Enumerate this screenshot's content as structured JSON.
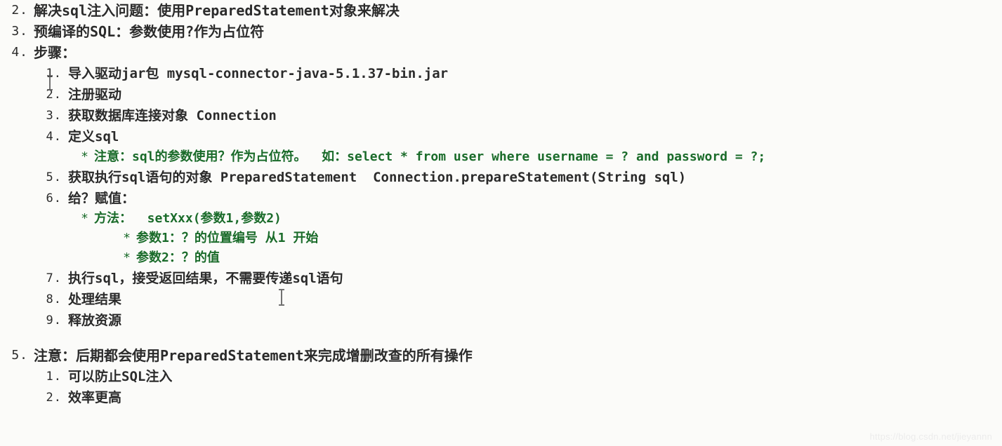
{
  "document": {
    "type": "markdown-outline-note",
    "topic": "PreparedStatement",
    "background_color": "#fbfbf9",
    "text_color": "#2b2b2b",
    "accent_color": "#1a6b2a"
  },
  "outline": {
    "item2": {
      "marker": "2.",
      "text": "解决sql注入问题：使用PreparedStatement对象来解决"
    },
    "item3": {
      "marker": "3.",
      "text": "预编译的SQL：参数使用?作为占位符"
    },
    "item4": {
      "marker": "4.",
      "text": "步骤：",
      "steps": [
        {
          "marker": "1.",
          "text": "导入驱动jar包 mysql-connector-java-5.1.37-bin.jar"
        },
        {
          "marker": "2.",
          "text": "注册驱动"
        },
        {
          "marker": "3.",
          "text": "获取数据库连接对象 Connection"
        },
        {
          "marker": "4.",
          "text": "定义sql"
        },
        {
          "marker": "5.",
          "text": "获取执行sql语句的对象 PreparedStatement  Connection.prepareStatement(String sql)"
        },
        {
          "marker": "6.",
          "text": "给？赋值："
        },
        {
          "marker": "7.",
          "text": "执行sql，接受返回结果，不需要传递sql语句"
        },
        {
          "marker": "8.",
          "text": "处理结果"
        },
        {
          "marker": "9.",
          "text": "释放资源"
        }
      ],
      "note_sql": {
        "marker": "*",
        "text": "注意：sql的参数使用？作为占位符。  如：select * from user where username = ? and password = ?;"
      },
      "note_method": {
        "marker": "*",
        "text": "方法：  setXxx(参数1,参数2)"
      },
      "note_param1": {
        "marker": "*",
        "text": "参数1：？的位置编号 从1 开始"
      },
      "note_param2": {
        "marker": "*",
        "text": "参数2：？的值"
      }
    },
    "item5": {
      "marker": "5.",
      "text": "注意：后期都会使用PreparedStatement来完成增删改查的所有操作",
      "reasons": [
        {
          "marker": "1.",
          "text": "可以防止SQL注入"
        },
        {
          "marker": "2.",
          "text": "效率更高"
        }
      ]
    }
  },
  "watermark": {
    "text": "https://blog.csdn.net/jieyannn"
  }
}
